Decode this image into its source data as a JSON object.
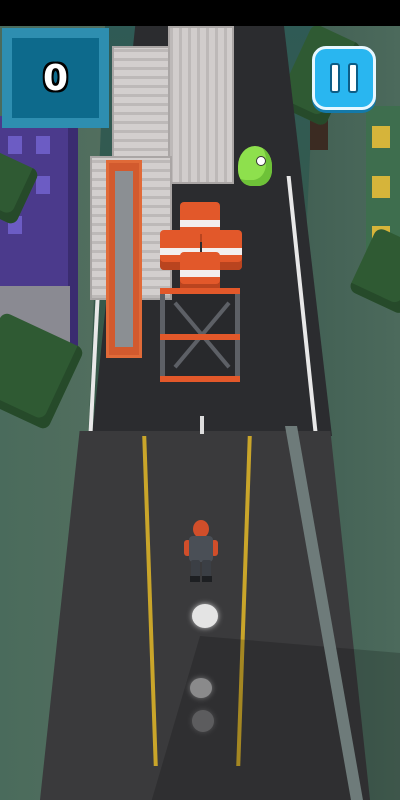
{
  "hud": {
    "score": "0",
    "pause_icon": "pause-icon"
  },
  "colors": {
    "hud_blue": "#2e8eb0",
    "pause_blue": "#29b6f0",
    "obstacle_orange": "#e2582a",
    "slime_green": "#8ee04d"
  }
}
